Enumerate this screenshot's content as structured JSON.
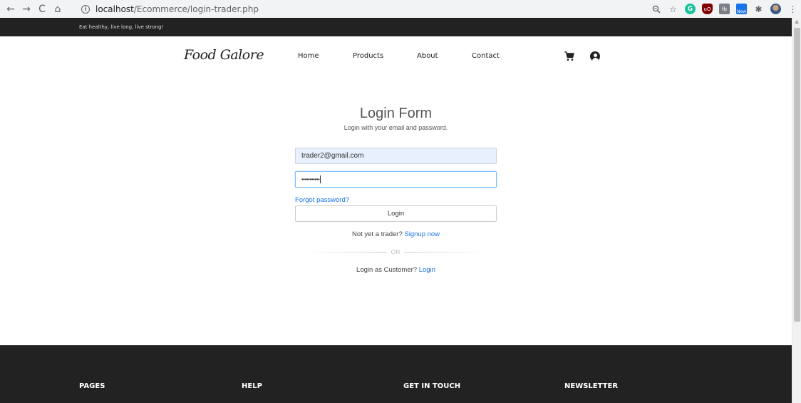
{
  "browser": {
    "url_host": "localhost",
    "url_path": "/Ecommerce/login-trader.php",
    "nav": {
      "back": "←",
      "forward": "→",
      "reload": "C",
      "home": "⌂"
    },
    "icons": [
      "zoom-icon",
      "star-icon",
      "grammarly-icon",
      "ublock-icon",
      "extension-box-icon",
      "new-extension-icon",
      "puzzle-icon",
      "avatar",
      "menu-dots-icon"
    ],
    "badge_new": "New"
  },
  "topbar": {
    "tagline": "Eat healthy, live long, live strong!"
  },
  "header": {
    "logo": "Food Galore",
    "menu": [
      "Home",
      "Products",
      "About",
      "Contact"
    ]
  },
  "login": {
    "title": "Login Form",
    "subtitle": "Login with your email and password.",
    "email_value": "trader2@gmail.com",
    "password_mask": "•••••••••••",
    "forgot": "Forgot password?",
    "button": "Login",
    "signup_prompt": "Not yet a trader?",
    "signup_link": "Signup now",
    "or_text": "OR",
    "customer_prompt": "Login as Customer?",
    "customer_link": "Login"
  },
  "footer": {
    "headings": [
      "PAGES",
      "HELP",
      "GET IN TOUCH",
      "NEWSLETTER"
    ]
  },
  "colors": {
    "link": "#1a73e8",
    "dark": "#222222",
    "autofill": "#e8f0fe"
  }
}
